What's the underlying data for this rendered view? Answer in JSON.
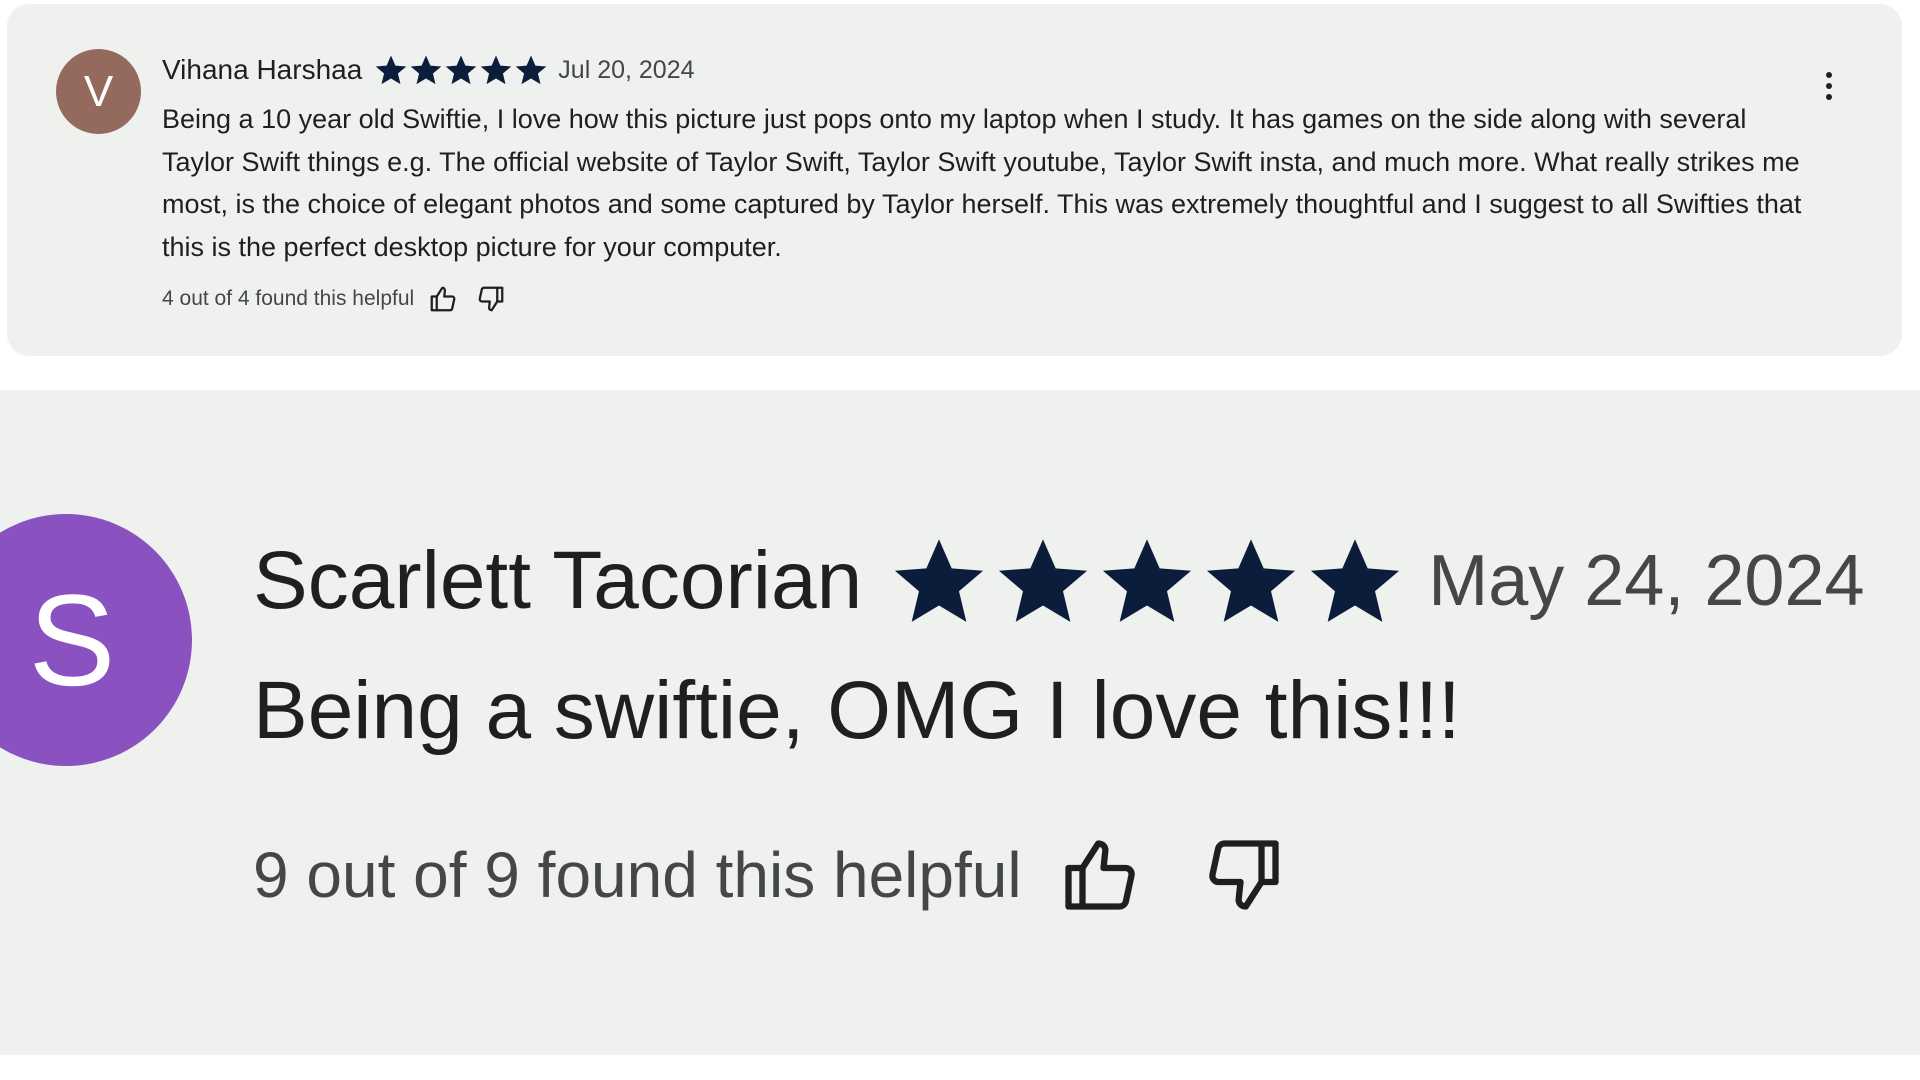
{
  "colors": {
    "card_background": "#eff1ef",
    "star_fill": "#0b1d3a",
    "text_primary": "#1f1f1f",
    "text_secondary": "#444746"
  },
  "reviews": [
    {
      "avatar_letter": "V",
      "avatar_color": "#946a5e",
      "author": "Vihana Harshaa",
      "rating": 5,
      "date": "Jul 20, 2024",
      "text": "Being a 10 year old Swiftie, I love how this picture just pops onto my laptop when I study. It has games on the side along with several Taylor Swift things e.g. The official website of Taylor Swift, Taylor Swift youtube, Taylor Swift insta, and much more. What really strikes me most, is the choice of elegant photos and some captured by Taylor herself. This was extremely thoughtful and I suggest to all Swifties that this is the perfect desktop picture for your computer.",
      "helpful": "4 out of 4 found this helpful",
      "icons": [
        "thumbs-up-icon",
        "thumbs-down-icon",
        "more-vert-icon"
      ]
    },
    {
      "avatar_letter": "S",
      "avatar_color": "#8a51c1",
      "author": "Scarlett Tacorian",
      "rating": 5,
      "date": "May 24, 2024",
      "text": "Being a swiftie, OMG I love this!!!",
      "helpful": "9 out of 9 found this helpful",
      "icons": [
        "thumbs-up-icon",
        "thumbs-down-icon"
      ]
    }
  ]
}
